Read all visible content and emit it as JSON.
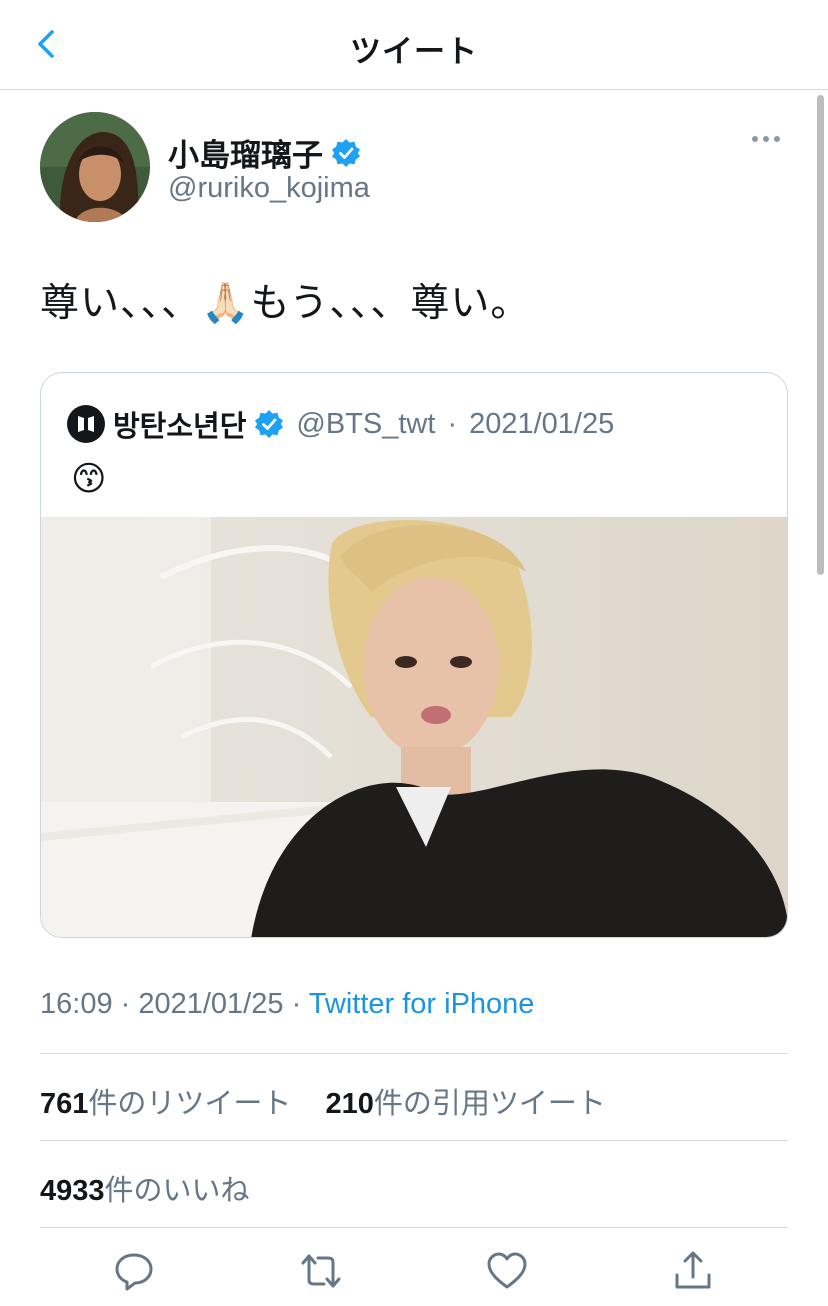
{
  "header": {
    "title": "ツイート",
    "back_icon": "chevron-left-icon"
  },
  "tweet": {
    "display_name": "小島瑠璃子",
    "handle": "@ruriko_kojima",
    "verified": true,
    "text": "尊い、、、🙏🏻もう、、、尊い。",
    "time": "16:09",
    "date": "2021/01/25",
    "separator": " · ",
    "source": "Twitter for iPhone"
  },
  "quoted": {
    "display_name": "방탄소년단",
    "handle": "@BTS_twt",
    "separator": "·",
    "date": "2021/01/25",
    "text": "😙",
    "logo_text": "BTS",
    "has_photo": true
  },
  "stats": {
    "retweets_count": "761",
    "retweets_label": "件のリツイート",
    "quotes_count": "210",
    "quotes_label": "件の引用ツイート",
    "likes_count": "4933",
    "likes_label": "件のいいね"
  },
  "actions": [
    "reply-icon",
    "retweet-icon",
    "like-icon",
    "share-icon"
  ],
  "colors": {
    "accent": "#1da1f2",
    "link": "#1b95e0",
    "muted": "#657786",
    "text": "#14171a"
  }
}
